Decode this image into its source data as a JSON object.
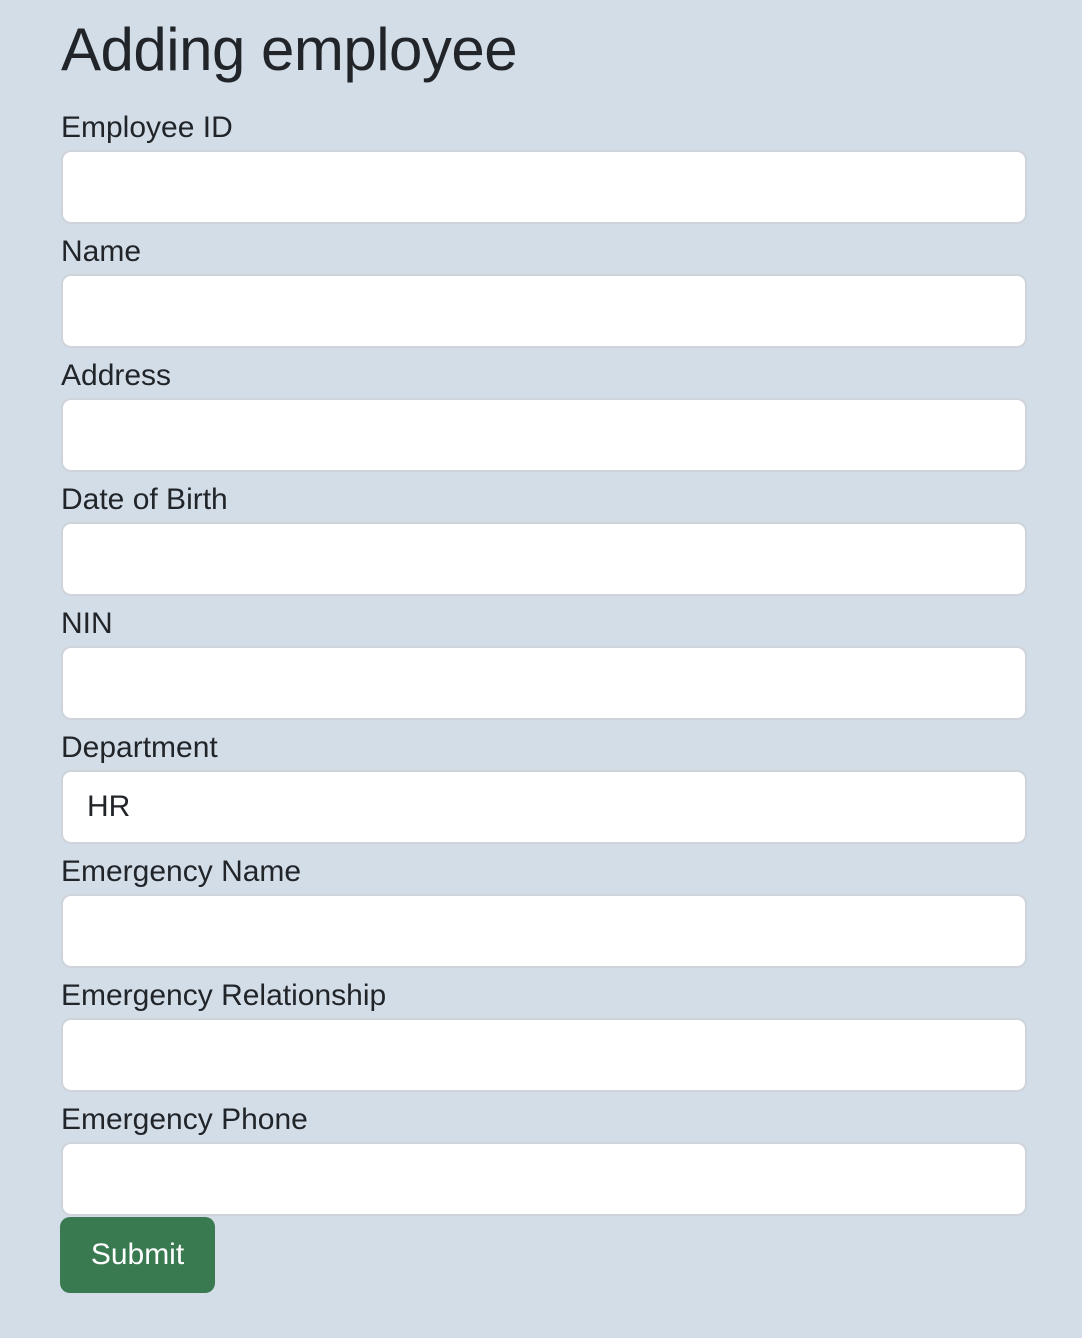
{
  "page": {
    "title": "Adding employee"
  },
  "form": {
    "fields": [
      {
        "label": "Employee ID",
        "value": ""
      },
      {
        "label": "Name",
        "value": ""
      },
      {
        "label": "Address",
        "value": ""
      },
      {
        "label": "Date of Birth",
        "value": ""
      },
      {
        "label": "NIN",
        "value": ""
      },
      {
        "label": "Department",
        "value": "HR"
      },
      {
        "label": "Emergency Name",
        "value": ""
      },
      {
        "label": "Emergency Relationship",
        "value": ""
      },
      {
        "label": "Emergency Phone",
        "value": ""
      }
    ],
    "submit_label": "Submit"
  },
  "colors": {
    "background": "#d3dde7",
    "submit": "#3a7a50"
  }
}
